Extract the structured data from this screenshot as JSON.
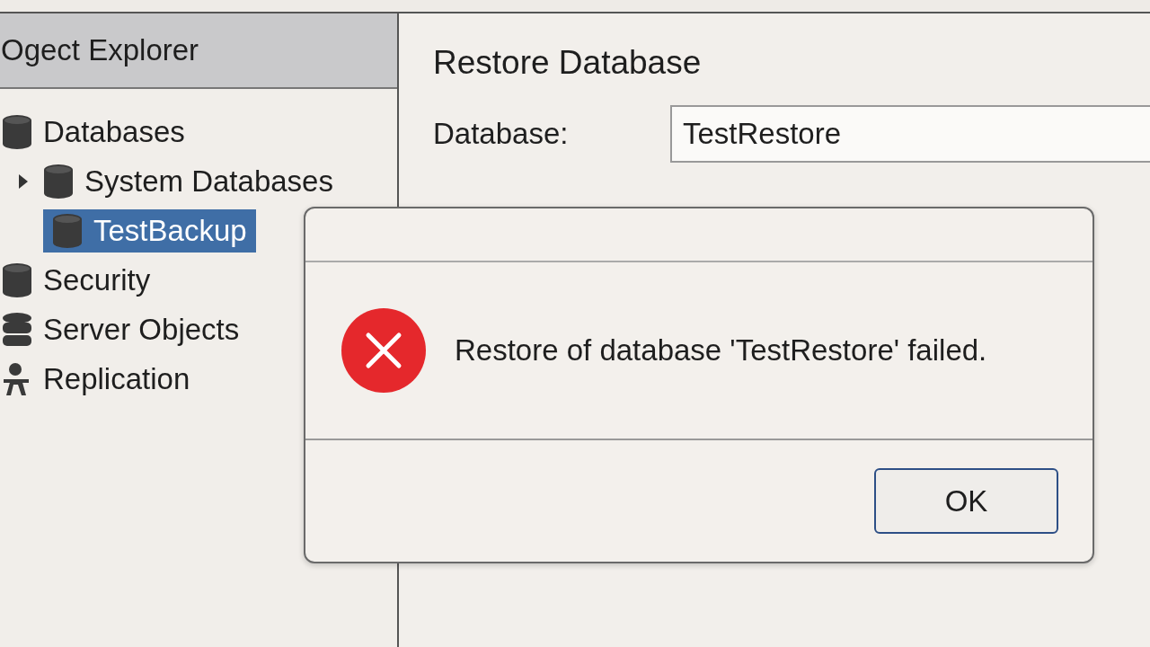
{
  "explorer": {
    "title": "Ogect Explorer",
    "tree": [
      {
        "label": "Databases",
        "selected": false,
        "children": [
          {
            "label": "System Databases",
            "selected": false,
            "expanded": false
          },
          {
            "label": "TestBackup",
            "selected": true
          }
        ]
      },
      {
        "label": "Security",
        "selected": false
      },
      {
        "label": "Server Objects",
        "selected": false
      },
      {
        "label": "Replication",
        "selected": false
      }
    ]
  },
  "restore": {
    "title": "Restore Database",
    "database_label": "Database:",
    "database_value": "TestRestore"
  },
  "dialog": {
    "message": "Restore of database 'TestRestore' failed.",
    "buttons": [
      "OK"
    ]
  }
}
